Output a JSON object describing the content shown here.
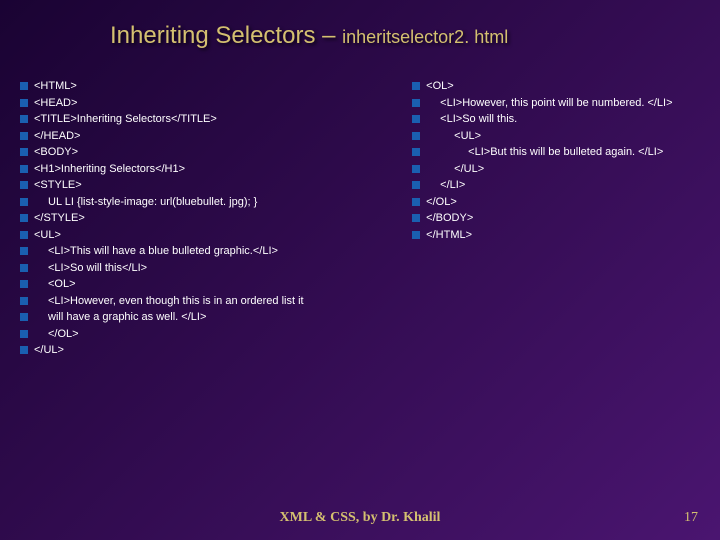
{
  "title_main": "Inheriting Selectors – ",
  "title_sub": "inheritselector2. html",
  "left": [
    {
      "ind": 0,
      "t": "<HTML>"
    },
    {
      "ind": 0,
      "t": "<HEAD>"
    },
    {
      "ind": 0,
      "t": "<TITLE>Inheriting Selectors</TITLE>"
    },
    {
      "ind": 0,
      "t": "</HEAD>"
    },
    {
      "ind": 0,
      "t": "<BODY>"
    },
    {
      "ind": 0,
      "t": "<H1>Inheriting Selectors</H1>"
    },
    {
      "ind": 0,
      "t": "<STYLE>"
    },
    {
      "ind": 1,
      "t": "UL LI {list-style-image: url(bluebullet. jpg); }"
    },
    {
      "ind": 0,
      "t": "</STYLE>"
    },
    {
      "ind": 0,
      "t": "<UL>"
    },
    {
      "ind": 1,
      "t": "<LI>This will have a blue bulleted graphic.</LI>"
    },
    {
      "ind": 1,
      "t": "<LI>So will this</LI>"
    },
    {
      "ind": 1,
      "t": "<OL>"
    },
    {
      "ind": 1,
      "t": "<LI>However, even though this is in an ordered list it"
    },
    {
      "ind": 1,
      "t": "will have a graphic as well. </LI>"
    },
    {
      "ind": 1,
      "t": "</OL>"
    },
    {
      "ind": 0,
      "t": "</UL>"
    }
  ],
  "right": [
    {
      "ind": 0,
      "t": "<OL>"
    },
    {
      "ind": 1,
      "t": "<LI>However, this point will be numbered. </LI>"
    },
    {
      "ind": 1,
      "t": "<LI>So will this."
    },
    {
      "ind": 2,
      "t": "<UL>"
    },
    {
      "ind": 3,
      "t": "<LI>But this will be bulleted again. </LI>"
    },
    {
      "ind": 2,
      "t": "</UL>"
    },
    {
      "ind": 1,
      "t": "</LI>"
    },
    {
      "ind": 0,
      "t": "</OL>"
    },
    {
      "ind": 0,
      "t": "</BODY>"
    },
    {
      "ind": 0,
      "t": "</HTML>"
    }
  ],
  "footer": "XML & CSS, by Dr. Khalil",
  "page": "17"
}
